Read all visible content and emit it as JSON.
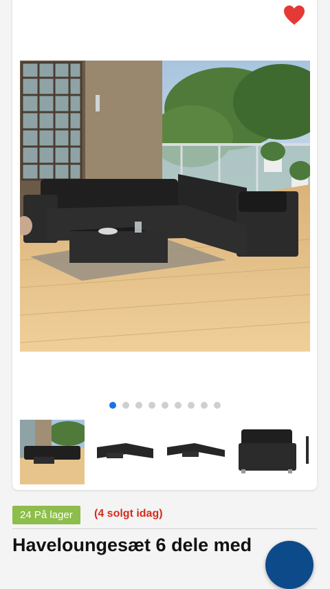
{
  "colors": {
    "heart": "#e53935",
    "dot_active": "#1a73e8",
    "dot_inactive": "#cfcfcf",
    "stock_badge": "#8dbd4a",
    "sold_text": "#d52b1e",
    "fab": "#0d4a8a"
  },
  "icons": {
    "favorite": "heart-icon"
  },
  "gallery": {
    "image_count": 9,
    "active_index": 0,
    "thumbnails": [
      "scene-thumbnail",
      "corner-set-thumbnail",
      "low-set-thumbnail",
      "corner-chair-thumbnail"
    ]
  },
  "product": {
    "stock_label": "24 På lager",
    "sold_today": "(4 solgt idag)",
    "title": "Haveloungesæt 6 dele med"
  }
}
